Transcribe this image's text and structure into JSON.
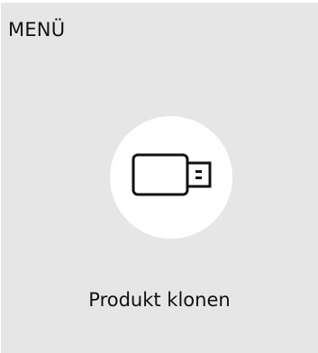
{
  "header": {
    "title": "MENÜ"
  },
  "tile": {
    "label": "Produkt klonen",
    "icon": "usb-drive-icon"
  },
  "colors": {
    "panel_background": "#e6e6e6",
    "icon_circle": "#ffffff",
    "text": "#111111"
  }
}
